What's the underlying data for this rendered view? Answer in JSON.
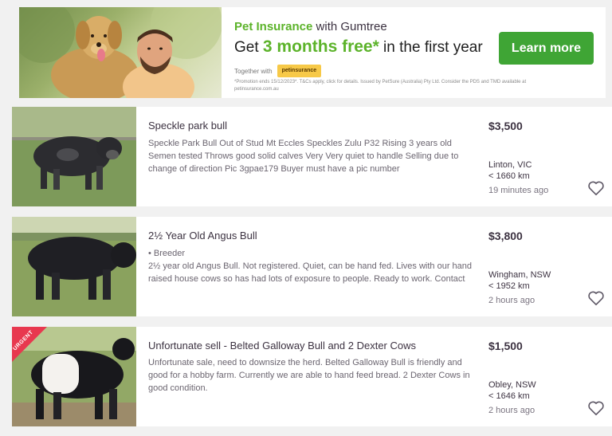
{
  "banner": {
    "title_brand": "Pet Insurance",
    "title_rest": " with Gumtree",
    "headline_pre": "Get ",
    "headline_highlight": "3 months free*",
    "headline_post": " in the first year",
    "together_label": "Together with",
    "partner_logo_text": "petinsurance",
    "disclaimer": "*Promotion ends 15/12/2023*. T&Cs apply, click for details. Issued by PetSure (Australia) Pty Ltd. Consider the PDS and TMD available at petinsurance.com.au",
    "button_label": "Learn more",
    "brand_color": "#5cb32a",
    "button_color": "#3fa535"
  },
  "listings": [
    {
      "title": "Speckle park bull",
      "tag": "",
      "description": "Speckle Park Bull Out of Stud Mt Eccles Speckles Zulu P32 Rising 3 years old Semen tested Throws good solid calves Very Very quiet to handle Selling due to change of direction Pic 3gpae179 Buyer must have a pic number",
      "price": "$3,500",
      "location": "Linton, VIC",
      "distance": "< 1660 km",
      "time": "19 minutes ago",
      "badge": ""
    },
    {
      "title": "2½ Year Old Angus Bull",
      "tag": "• Breeder",
      "description": "2½ year old Angus Bull. Not registered. Quiet, can be hand fed. Lives with our hand raised house cows so has had lots of exposure to people. Ready to work. Contact",
      "price": "$3,800",
      "location": "Wingham, NSW",
      "distance": "< 1952 km",
      "time": "2 hours ago",
      "badge": ""
    },
    {
      "title": "Unfortunate sell - Belted Galloway Bull and 2 Dexter Cows",
      "tag": "",
      "description": "Unfortunate sale, need to downsize the herd. Belted Galloway Bull is friendly and good for a hobby farm. Currently we are able to hand feed bread. 2 Dexter Cows in good condition.",
      "price": "$1,500",
      "location": "Obley, NSW",
      "distance": "< 1646 km",
      "time": "2 hours ago",
      "badge": "URGENT"
    }
  ],
  "icons": {
    "favourite": "heart-outline-icon"
  }
}
